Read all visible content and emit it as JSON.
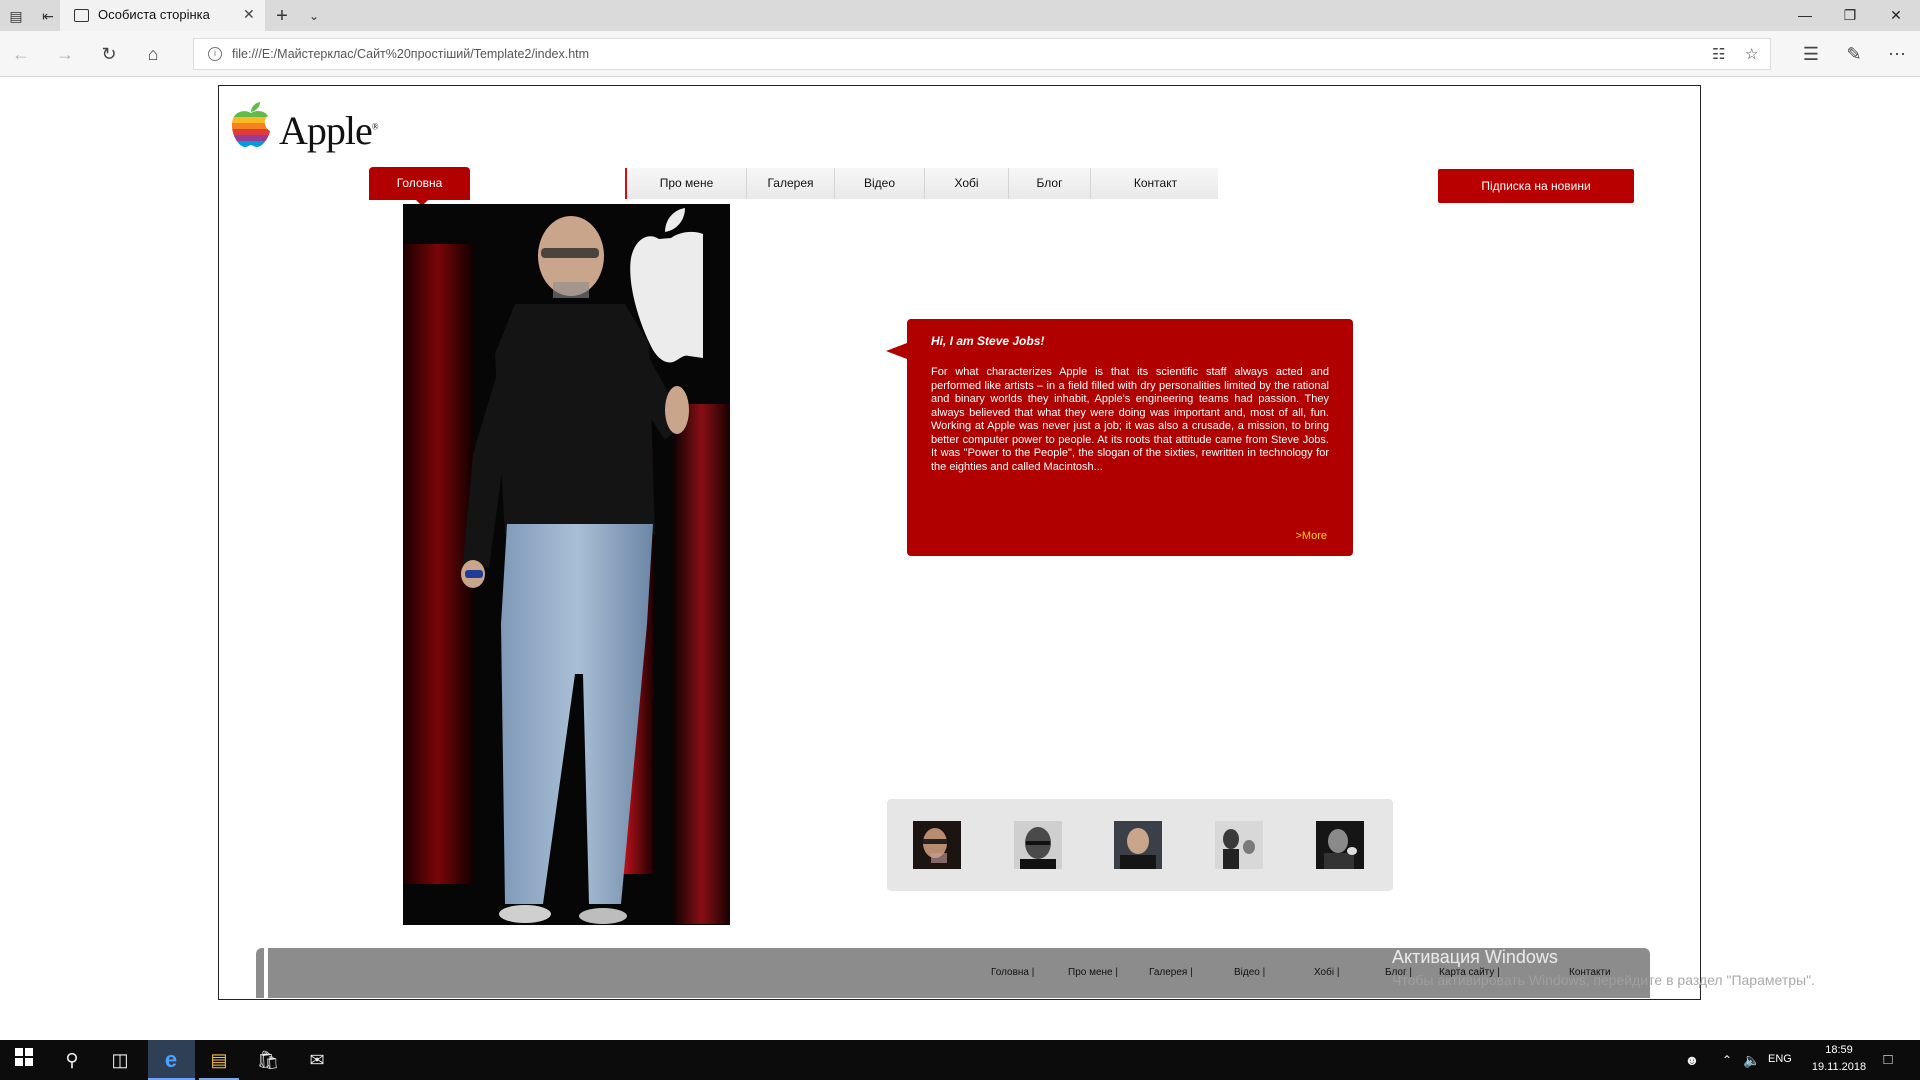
{
  "browser": {
    "tab_title": "Особиста сторінка",
    "url": "file:///E:/Майстерклас/Сайт%20простіший/Template2/index.htm"
  },
  "site": {
    "logo_text": "Apple",
    "logo_reg": "®",
    "home_label": "Головна",
    "menu": [
      "Про мене",
      "Галерея",
      "Відео",
      "Хобі",
      "Блог",
      "Контакт"
    ],
    "subscribe_label": "Підписка на новини",
    "bubble": {
      "title": "Hi, I am Steve Jobs!",
      "text": "For what characterizes Apple is that its scientific staff always acted and performed like artists – in a field filled with dry personalities limited by the rational and binary worlds they inhabit, Apple's engineering teams had passion. They always believed that what they were doing was important and, most of all, fun. Working at Apple was never just a job; it was also a crusade, a mission, to bring better computer power to people. At its roots that attitude came from Steve Jobs. It was \"Power to the People\", the slogan of the sixties, rewritten in technology for the eighties and called Macintosh...",
      "more": ">More"
    },
    "footer_links": [
      "Головна |",
      "Про мене |",
      "Галерея |",
      "Відео |",
      "Хобі |",
      "Блог |",
      "Карта сайту |",
      "Контакти"
    ]
  },
  "activation": {
    "title": "Активация Windows",
    "subtitle": "Чтобы активировать Windows, перейдите в раздел \"Параметры\"."
  },
  "taskbar": {
    "lang": "ENG",
    "time": "18:59",
    "date": "19.11.2018"
  },
  "colors": {
    "accent_red": "#b00000",
    "more_link": "#ffd300",
    "footer_gray": "#8c8c8c"
  }
}
